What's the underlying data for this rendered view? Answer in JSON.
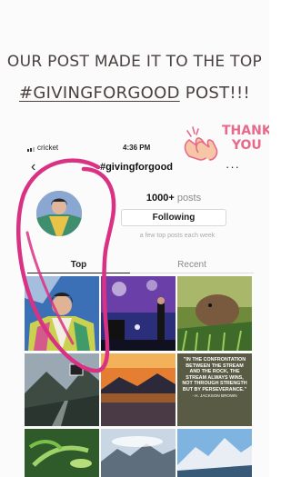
{
  "headline": {
    "line1": "OUR POST MADE IT TO THE TOP",
    "hashtag": "#GIVINGFORGOOD",
    "line2_suffix": " POST!!!"
  },
  "thank_you": {
    "line1": "THANK",
    "line2": "YOU"
  },
  "status_bar": {
    "carrier": "cricket",
    "time": "4:36 PM"
  },
  "nav": {
    "back_icon": "chevron-left-icon",
    "title": "#givingforgood",
    "more": "···"
  },
  "profile": {
    "posts_count": "1000+",
    "posts_label": " posts",
    "follow_button": "Following",
    "caption": "a few top posts each week"
  },
  "tabs": {
    "top": "Top",
    "recent": "Recent"
  },
  "grid_tiles": [
    {
      "kind": "person-portrait"
    },
    {
      "kind": "stage-performance"
    },
    {
      "kind": "rodent-in-grass"
    },
    {
      "kind": "misty-mountain-road"
    },
    {
      "kind": "sunset-lake"
    },
    {
      "kind": "quote-tile",
      "quote": "\"IN THE CONFRONTATION BETWEEN THE STREAM AND THE ROCK, THE STREAM ALWAYS WINS, NOT THROUGH STRENGTH BUT BY PERSEVERANCE.\"",
      "author": "- H. JACKSON BROWN"
    },
    {
      "kind": "green-plant"
    },
    {
      "kind": "mountain-clouds"
    },
    {
      "kind": "snowy-peaks"
    }
  ],
  "colors": {
    "annotation": "#d93183",
    "thanks": "#e86a8a",
    "headline": "#4a4040"
  }
}
